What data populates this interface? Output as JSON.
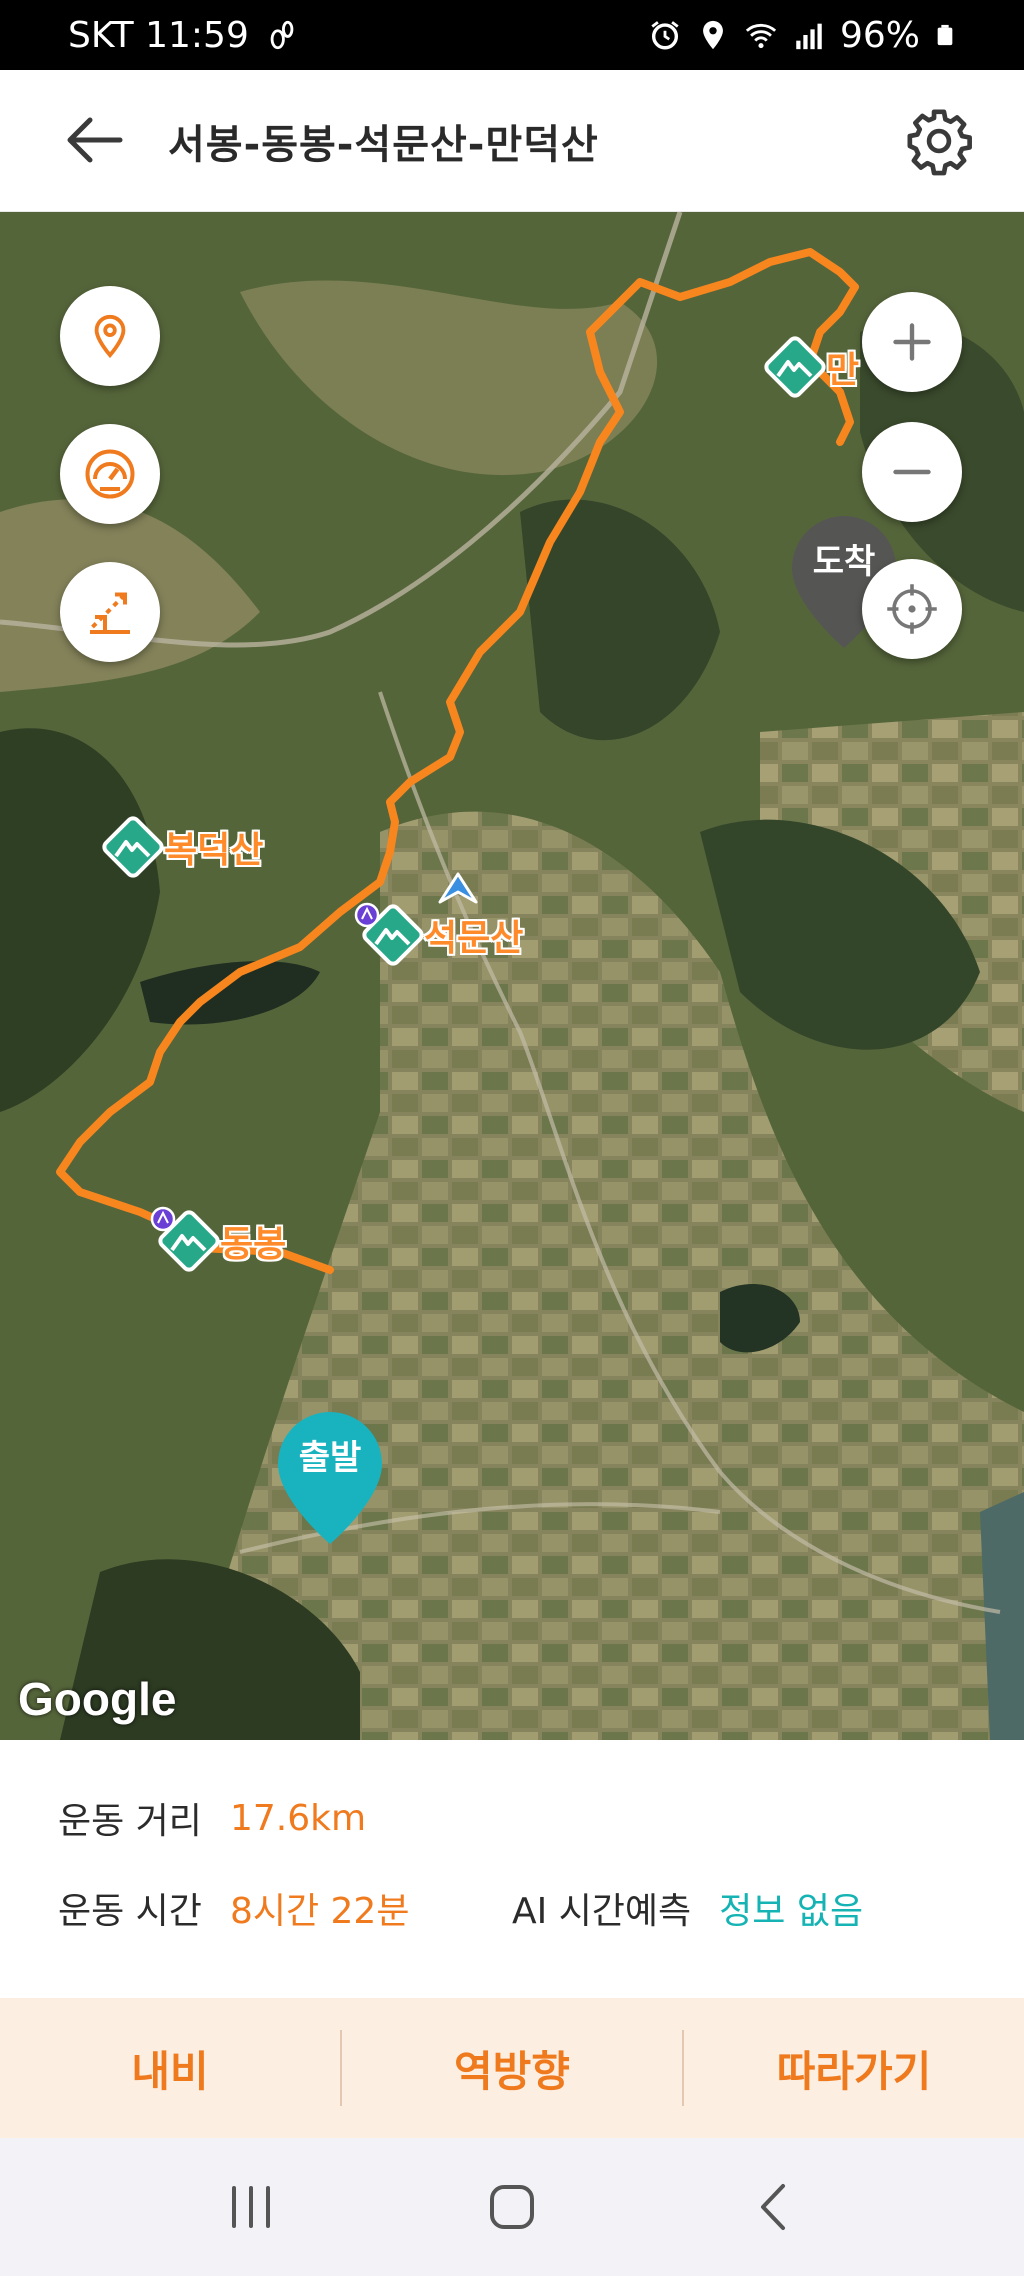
{
  "status_bar": {
    "carrier_time": "SKT 11:59",
    "battery": "96%",
    "icons": [
      "footprint-icon",
      "alarm-icon",
      "location-icon",
      "wifi-icon",
      "signal-icon",
      "battery-icon"
    ]
  },
  "header": {
    "title": "서봉-동봉-석문산-만덕산",
    "back_icon": "arrow-left-icon",
    "settings_icon": "gear-icon"
  },
  "map": {
    "peaks": [
      {
        "label": "만"
      },
      {
        "label": "복덕산"
      },
      {
        "label": "석문산"
      },
      {
        "label": "동봉"
      }
    ],
    "start_pin": "출발",
    "end_pin": "도착",
    "attribution": "Google",
    "route_color": "#f7861f",
    "peak_color": "#27a889",
    "start_pin_color": "#19b3c0",
    "end_pin_color": "#555555",
    "controls": [
      "location-pin-icon",
      "speedometer-icon",
      "elevation-icon",
      "zoom-in-icon",
      "zoom-out-icon",
      "crosshair-icon"
    ]
  },
  "info": {
    "distance_label": "운동 거리",
    "distance_value": "17.6km",
    "time_label": "운동 시간",
    "time_value": "8시간 22분",
    "ai_label": "AI 시간예측",
    "ai_value": "정보 없음"
  },
  "actions": {
    "navi": "내비",
    "reverse": "역방향",
    "follow": "따라가기"
  },
  "nav_bar": {
    "icons": [
      "recents-icon",
      "home-icon",
      "back-icon"
    ]
  }
}
